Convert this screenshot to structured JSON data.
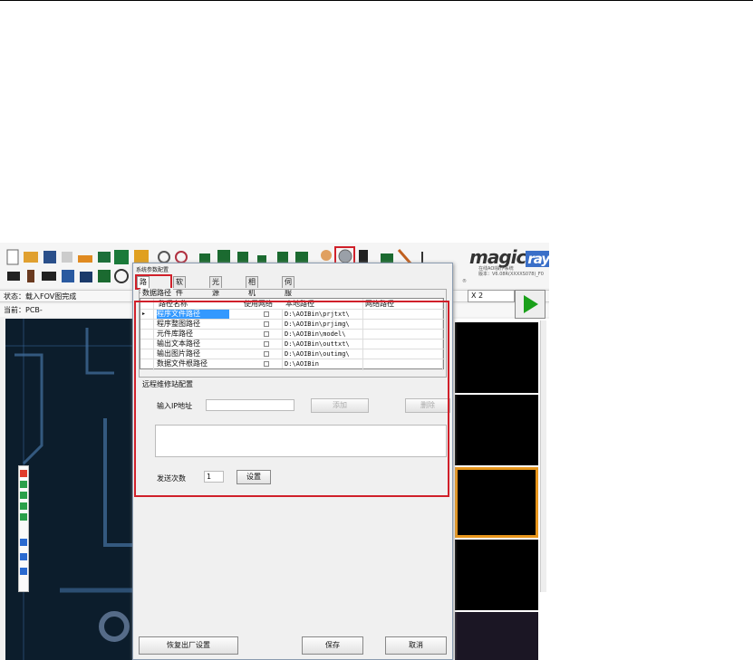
{
  "app": {
    "status_text": "状态：载入FOV图完成",
    "current_text": "当前：PCB-",
    "zoom_text": "X 2",
    "logo_main": "magic",
    "logo_ray": "ray",
    "logo_sub1": "在线AOI操作系统",
    "logo_sub2": "版本：V6.08R(XXXXS078)_F0",
    "logo_mark": "®"
  },
  "dialog": {
    "title": "系统参数配置",
    "tabs": [
      {
        "label": "路径配置"
      },
      {
        "label": "软件配置"
      },
      {
        "label": "光源配置"
      },
      {
        "label": "相机配置"
      },
      {
        "label": "伺服步进配置"
      }
    ],
    "path_group_label": "数据路径",
    "columns": [
      "路径名称",
      "使用网络",
      "本地路径",
      "网络路径"
    ],
    "rows": [
      {
        "name": "程序文件路径",
        "local": "D:\\AOIBin\\prjtxt\\"
      },
      {
        "name": "程序整图路径",
        "local": "D:\\AOIBin\\prjimg\\"
      },
      {
        "name": "元件库路径",
        "local": "D:\\AOIBin\\model\\"
      },
      {
        "name": "输出文本路径",
        "local": "D:\\AOIBin\\outtxt\\"
      },
      {
        "name": "输出图片路径",
        "local": "D:\\AOIBin\\outimg\\"
      },
      {
        "name": "数据文件根路径",
        "local": "D:\\AOIBin"
      }
    ],
    "remote_section_label": "远程维修站配置",
    "ip_label": "输入IP地址",
    "ip_value": "",
    "add_button": "添加",
    "delete_button": "删除",
    "send_count_label": "发送次数",
    "send_count_value": "1",
    "settings_button": "设置",
    "restore_button": "恢复出厂设置",
    "save_button": "保存",
    "cancel_button": "取消"
  },
  "colors": {
    "highlight_red": "#d0202a",
    "selection_blue": "#3399ff",
    "play_green": "#1aa01a",
    "thumb_selected_border": "#e8961c"
  }
}
